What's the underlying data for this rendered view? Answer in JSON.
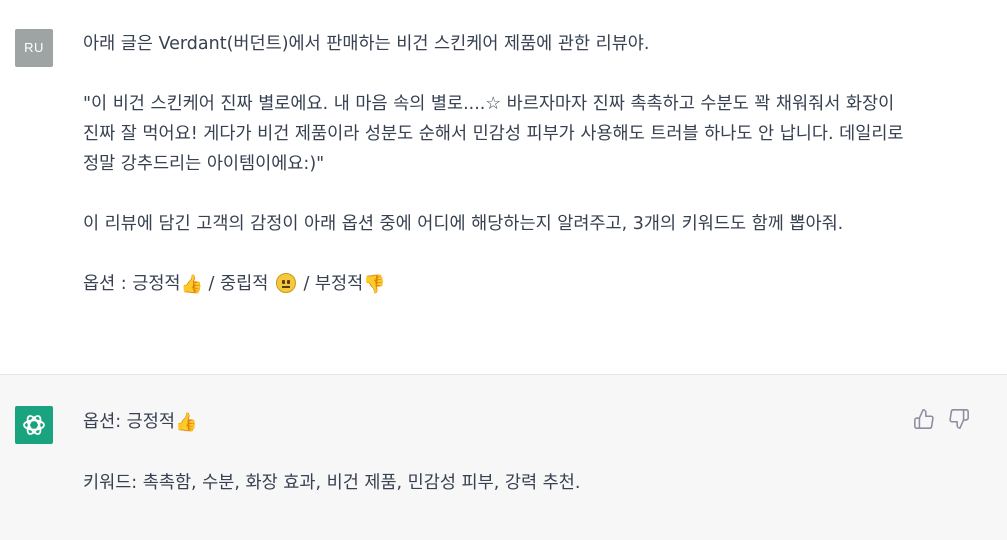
{
  "user": {
    "avatar_initials": "RU",
    "paragraphs": [
      "아래 글은 Verdant(버던트)에서 판매하는 비건 스킨케어 제품에 관한 리뷰야.",
      "\"이 비건 스킨케어 진짜 별로에요. 내 마음 속의 별로....☆ 바르자마자 진짜 촉촉하고 수분도 꽉 채워줘서 화장이 진짜 잘 먹어요! 게다가 비건 제품이라 성분도 순해서 민감성 피부가 사용해도 트러블 하나도 안 납니다. 데일리로 정말 강추드리는 아이템이에요:)\"",
      "이 리뷰에 담긴 고객의 감정이 아래 옵션 중에 어디에 해당하는지 알려주고, 3개의 키워드도 함께 뽑아줘."
    ],
    "options": {
      "prefix": "옵션 : ",
      "positive": "긍정적",
      "sep1": " / ",
      "neutral": "중립적",
      "sep2": " / ",
      "negative": "부정적"
    }
  },
  "assistant": {
    "avatar_icon": "openai-logo-icon",
    "answer_prefix": "옵션: 긍정적",
    "keywords": "키워드: 촉촉함, 수분, 화장 효과, 비건 제품, 민감성 피부, 강력 추천.",
    "feedback": {
      "thumbs_up_icon": "thumbs-up-icon",
      "thumbs_down_icon": "thumbs-down-icon"
    }
  },
  "colors": {
    "user_avatar_bg": "#9ea4a3",
    "bot_avatar_bg": "#19a37f",
    "assistant_bg": "#f7f7f8",
    "text": "#374151",
    "icon": "#8e8ea0"
  }
}
